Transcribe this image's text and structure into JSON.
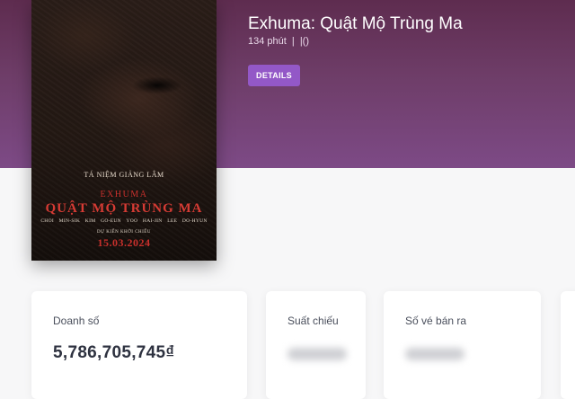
{
  "movie": {
    "title": "Exhuma: Quật Mộ Trùng Ma",
    "duration": "134 phút",
    "separator": "|",
    "extra": "|()",
    "details_label": "DETAILS"
  },
  "poster": {
    "tagline": "TÁ NIỆM GIẢNG LÂM",
    "title_en": "EXHUMA",
    "title_vi": "QUẬT MỘ TRÙNG MA",
    "cast": "CHOI MIN-SIK  KIM GO-EUN  YOO HAI-JIN  LEE DO-HYUN",
    "release_label": "DỰ KIẾN KHỞI CHIẾU",
    "release_date": "15.03.2024"
  },
  "stats": [
    {
      "label": "Doanh số",
      "value": "5,786,705,745₫"
    },
    {
      "label": "Suất chiếu",
      "value": null
    },
    {
      "label": "Số vé bán ra",
      "value": null
    }
  ],
  "colors": {
    "hero_top": "#5e2c4f",
    "hero_bottom": "#7d4a86",
    "accent_button": "#9358c7",
    "poster_red": "#d63b34"
  }
}
